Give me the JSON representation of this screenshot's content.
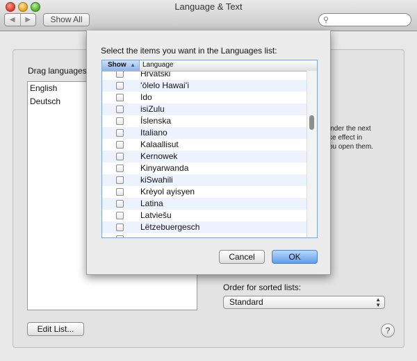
{
  "window": {
    "title": "Language & Text"
  },
  "toolbar": {
    "back_glyph": "◀",
    "forward_glyph": "▶",
    "show_all_label": "Show All",
    "search_placeholder": ""
  },
  "pane": {
    "drag_label": "Drag languages into your preferred order.",
    "languages": [
      "English",
      "Deutsch"
    ],
    "edit_list_label": "Edit List...",
    "note_lines": [
      "inder the next",
      "ke effect in",
      "ou open them."
    ],
    "sorted_label": "Order for sorted lists:",
    "sorted_value": "Standard",
    "help_label": "?"
  },
  "sheet": {
    "title": "Select the items you want in the Languages list:",
    "col_show": "Show",
    "col_language": "Language",
    "rows": [
      {
        "name": "Hrvatski",
        "checked": false
      },
      {
        "name": "ʻōlelo Hawaiʻi",
        "checked": false
      },
      {
        "name": "Ido",
        "checked": false
      },
      {
        "name": "isiZulu",
        "checked": false
      },
      {
        "name": "Íslenska",
        "checked": false
      },
      {
        "name": "Italiano",
        "checked": false
      },
      {
        "name": "Kalaallisut",
        "checked": false
      },
      {
        "name": "Kernowek",
        "checked": false
      },
      {
        "name": "Kinyarwanda",
        "checked": false
      },
      {
        "name": "kiSwahili",
        "checked": false
      },
      {
        "name": "Krèyol ayisyen",
        "checked": false
      },
      {
        "name": "Latina",
        "checked": false
      },
      {
        "name": "Latviešu",
        "checked": false
      },
      {
        "name": "Lëtzebuergesch",
        "checked": false
      },
      {
        "name": "",
        "checked": false
      }
    ],
    "cancel_label": "Cancel",
    "ok_label": "OK"
  },
  "colors": {
    "ok_button": "#6aa6ec",
    "header_selected": "#8db4e8"
  }
}
